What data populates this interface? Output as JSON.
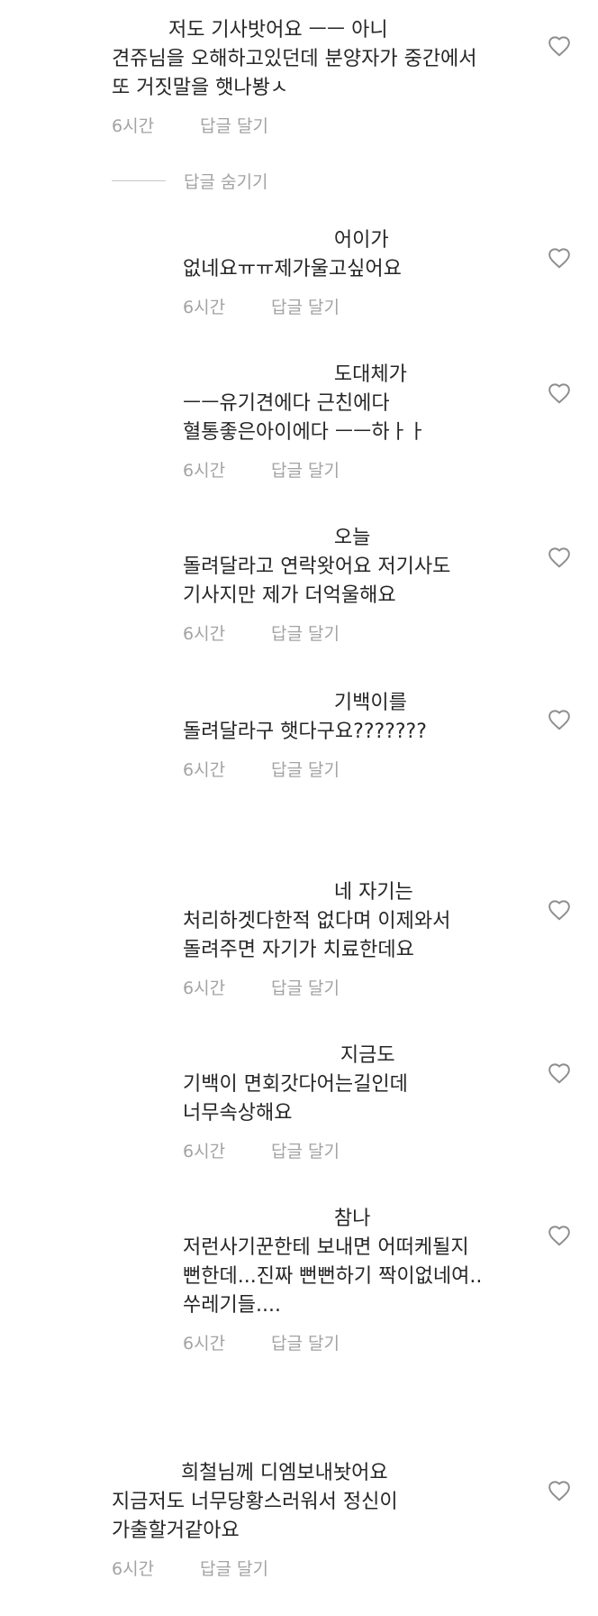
{
  "comments": [
    {
      "text": "         저도 기사밧어요 ㅡㅡ 아니\n견쥬님을 오해하고있던데 분양자가 중간에서\n또 거짓말을 햇나봥ㅅ",
      "time": "6시간",
      "reply": "답글 달기"
    },
    {
      "text": "                        어이가\n없네요ㅠㅠ제가울고싶어요",
      "time": "6시간",
      "reply": "답글 달기"
    },
    {
      "text": "                        도대체가\nㅡㅡ유기견에다 근친에다\n혈통좋은아이에다 ㅡㅡ하ㅏㅏ",
      "time": "6시간",
      "reply": "답글 달기"
    },
    {
      "text": "                        오늘\n돌려달라고 연락왓어요 저기사도\n기사지만 제가 더억울해요",
      "time": "6시간",
      "reply": "답글 달기"
    },
    {
      "text": "                        기백이를\n돌려달라구 햇다구요???????",
      "time": "6시간",
      "reply": "답글 달기"
    },
    {
      "text": "                        네 자기는\n처리하겟다한적 없다며 이제와서\n돌려주면 자기가 치료한데요",
      "time": "6시간",
      "reply": "답글 달기"
    },
    {
      "text": "                         지금도\n기백이 면회갓다어는길인데\n너무속상해요",
      "time": "6시간",
      "reply": "답글 달기"
    },
    {
      "text": "                        참나\n저런사기꾼한테 보내면 어떠케될지\n뻔한데...진짜 뻔뻔하기 짝이없네여..\n쑤레기들....",
      "time": "6시간",
      "reply": "답글 달기"
    },
    {
      "text": "           희철님께 디엠보내놧어요\n지금저도 너무당황스러워서 정신이\n가출할거같아요",
      "time": "6시간",
      "reply": "답글 달기"
    }
  ],
  "hide_replies_label": "답글 숨기기",
  "icons": {
    "like": "heart-outline-icon"
  },
  "colors": {
    "text": "#262626",
    "meta": "#a3a3a3",
    "heart": "#8e8e8e"
  }
}
